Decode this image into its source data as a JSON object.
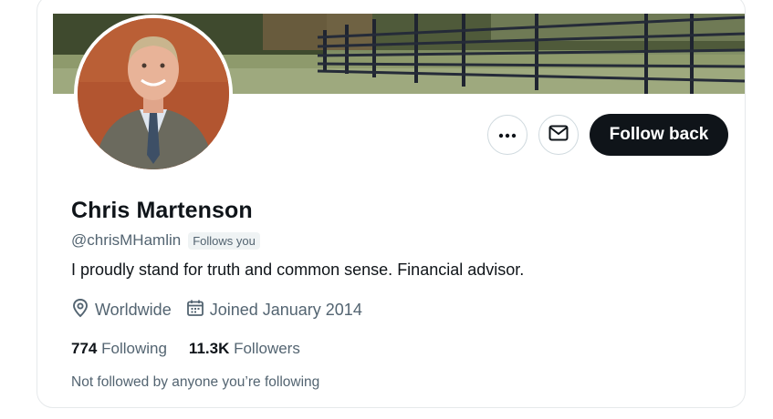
{
  "profile": {
    "name": "Chris Martenson",
    "handle": "@chrisMHamlin",
    "follows_you_badge": "Follows you",
    "bio": "I proudly stand for truth and common sense. Financial advisor.",
    "location": "Worldwide",
    "joined": "Joined January 2014",
    "following_count": "774",
    "following_label": "Following",
    "followers_count": "11.3K",
    "followers_label": "Followers",
    "mutuals_text": "Not followed by anyone you’re following"
  },
  "actions": {
    "more_icon": "more-dots-icon",
    "message_icon": "envelope-icon",
    "follow_back_label": "Follow back"
  },
  "icons": {
    "location": "location-pin-icon",
    "calendar": "calendar-icon"
  },
  "colors": {
    "primary_text": "#0f1419",
    "secondary_text": "#536471",
    "button_dark": "#0f1419",
    "border": "#cfd9de"
  }
}
